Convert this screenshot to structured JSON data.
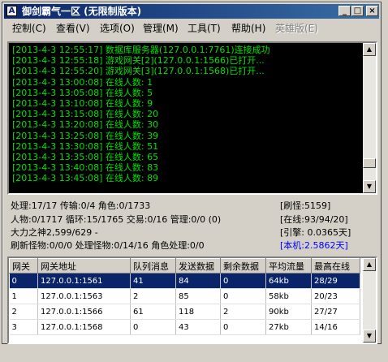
{
  "window": {
    "title": "御剑霸气一区 (无限制版本)",
    "icon": "app-icon",
    "controls": {
      "minimize": "_",
      "maximize": "□",
      "close": "×"
    }
  },
  "menu": [
    {
      "label": "控制(C)",
      "disabled": false
    },
    {
      "label": "查看(V)",
      "disabled": false
    },
    {
      "label": "选项(O)",
      "disabled": false
    },
    {
      "label": "管理(M)",
      "disabled": false
    },
    {
      "label": "工具(T)",
      "disabled": false
    },
    {
      "label": "帮助(H)",
      "disabled": false
    },
    {
      "label": "英雄版(E)",
      "disabled": true
    }
  ],
  "log": [
    "[2013-4-3 12:55:17] 数据库服务器(127.0.0.1:7761)连接成功",
    "[2013-4-3 12:55:18] 游戏网关[2](127.0.0.1:1566)已打开...",
    "[2013-4-3 12:55:20] 游戏网关[3](127.0.0.1:1568)已打开...",
    "[2013-4-3 13:00:08] 在线人数: 1",
    "[2013-4-3 13:05:08] 在线人数: 5",
    "[2013-4-3 13:10:08] 在线人数: 9",
    "[2013-4-3 13:15:08] 在线人数: 20",
    "[2013-4-3 13:20:08] 在线人数: 30",
    "[2013-4-3 13:25:08] 在线人数: 39",
    "[2013-4-3 13:30:08] 在线人数: 51",
    "[2013-4-3 13:35:08] 在线人数: 65",
    "[2013-4-3 13:40:08] 在线人数: 83",
    "[2013-4-3 13:45:08] 在线人数: 89"
  ],
  "stats": {
    "line1": "处理:17/17 传输:0/4 角色:0/1733",
    "line2": "人物:0/1717 循环:15/1765 交易:0/16 管理:0/0 (0)",
    "line3": "大力之神2,599/629 -",
    "line4": "刷新怪物:0/0/0 处理怪物:0/14/16 角色处理:0/0",
    "right1": "[刷怪:5159]",
    "right2": "[在线:93/94/20]",
    "right3": "[引擎: 0.0365天]",
    "right4": "[本机:2.5862天]"
  },
  "table": {
    "headers": [
      "网关",
      "网关地址",
      "队列消息",
      "发送数据",
      "剩余数据",
      "平均流量",
      "最高在线"
    ],
    "rows": [
      [
        "0",
        "127.0.0.1:1561",
        "41",
        "84",
        "0",
        "64kb",
        "28/29"
      ],
      [
        "1",
        "127.0.0.1:1563",
        "2",
        "85",
        "0",
        "58kb",
        "20/23"
      ],
      [
        "2",
        "127.0.0.1:1566",
        "61",
        "118",
        "2",
        "90kb",
        "27/27"
      ],
      [
        "3",
        "127.0.0.1:1568",
        "0",
        "43",
        "0",
        "27kb",
        "14/16"
      ]
    ],
    "selected_row": 0
  },
  "colors": {
    "log_text": "#00e000",
    "selection": "#0a246a",
    "accent_blue": "#0000ff"
  }
}
